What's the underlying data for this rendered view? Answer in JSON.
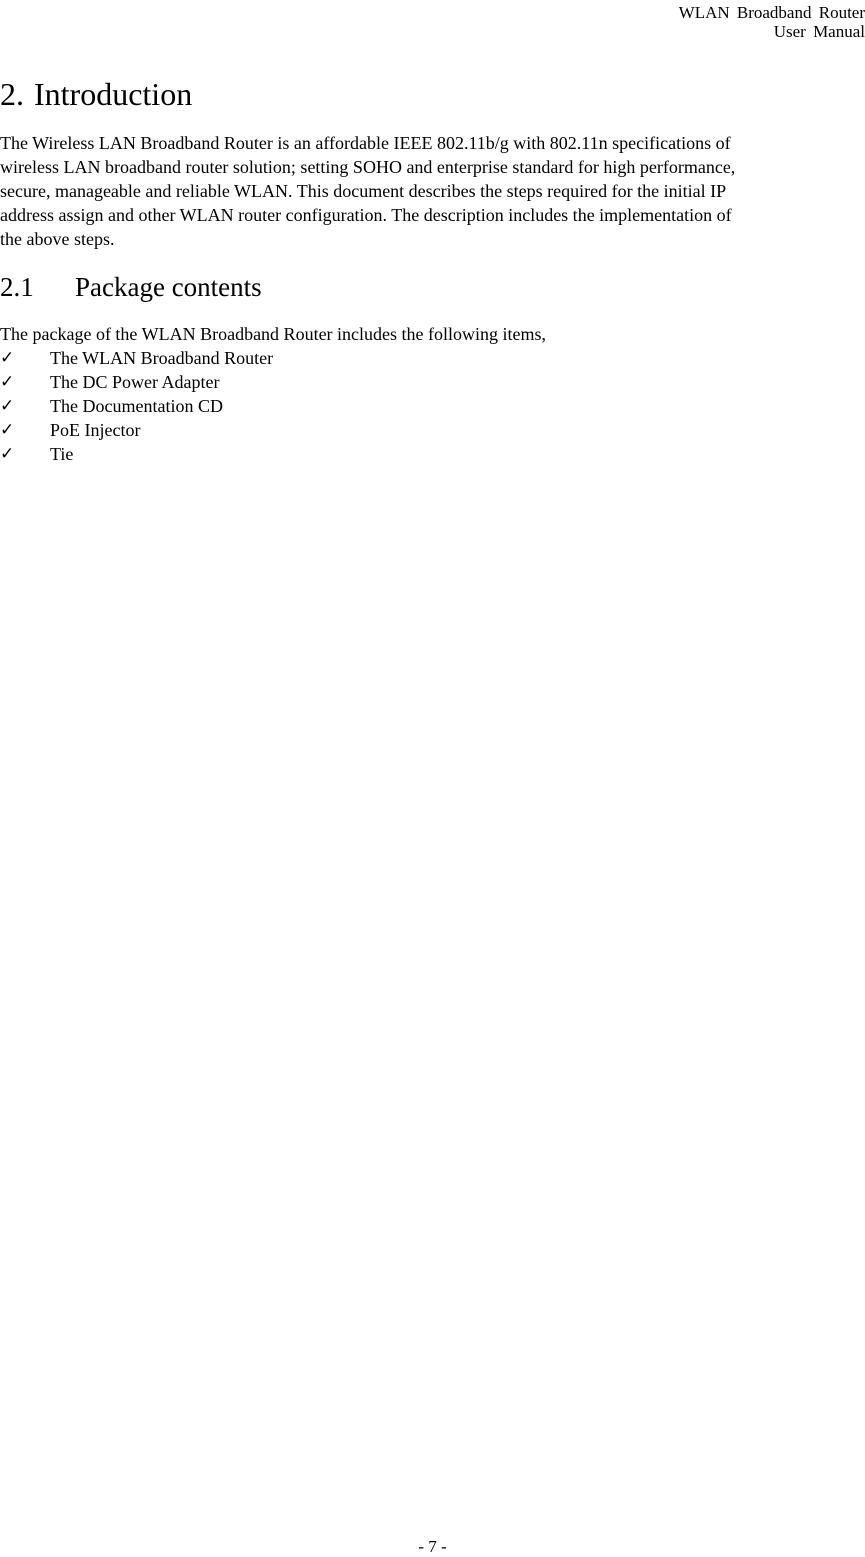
{
  "header": {
    "line1": "WLAN Broadband Router",
    "line2": "User Manual"
  },
  "section": {
    "number": "2.",
    "title": "Introduction",
    "paragraph_lines": [
      "The Wireless LAN Broadband Router is an affordable IEEE 802.11b/g with 802.11n specifications of",
      "wireless LAN broadband router solution; setting SOHO and enterprise standard for high performance,",
      "secure, manageable and reliable WLAN. This document describes the steps required for the initial IP",
      "address assign and other WLAN router configuration. The description includes the implementation of",
      "the above steps."
    ]
  },
  "subsection": {
    "number": "2.1",
    "title": "Package contents",
    "intro": "The package of the WLAN Broadband Router includes the following items,",
    "bullet_icon": "checkmark-icon",
    "bullet_glyph": "✓",
    "items": [
      "The WLAN Broadband Router",
      "The DC Power Adapter",
      "The Documentation CD",
      "PoE Injector",
      "Tie"
    ]
  },
  "footer": {
    "page_number": "- 7 -"
  }
}
